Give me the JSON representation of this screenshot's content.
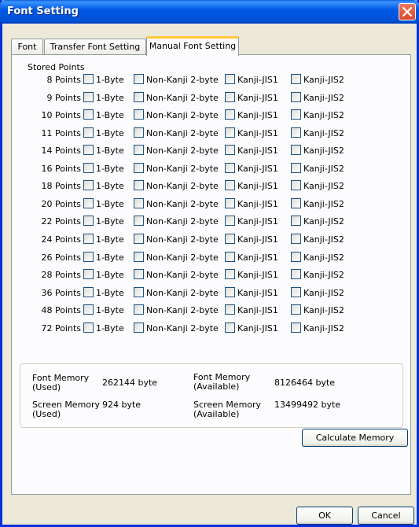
{
  "window": {
    "title": "Font Setting"
  },
  "tabs": [
    {
      "label": "Font"
    },
    {
      "label": "Transfer Font Setting"
    },
    {
      "label": "Manual Font Setting"
    }
  ],
  "stored_points": {
    "caption": "Stored Points",
    "columns": [
      "1-Byte",
      "Non-Kanji 2-byte",
      "Kanji-JIS1",
      "Kanji-JIS2"
    ],
    "rows": [
      "8 Points",
      "9 Points",
      "10 Points",
      "11 Points",
      "14 Points",
      "16 Points",
      "18 Points",
      "20 Points",
      "22 Points",
      "24 Points",
      "26 Points",
      "28 Points",
      "36 Points",
      "48 Points",
      "72 Points"
    ],
    "checked": false
  },
  "memory": {
    "font_used_label": "Font Memory (Used)",
    "font_used_value": "262144 byte",
    "font_avail_label": "Font Memory (Available)",
    "font_avail_value": "8126464 byte",
    "screen_used_label": "Screen Memory (Used)",
    "screen_used_value": "924 byte",
    "screen_avail_label": "Screen Memory (Available)",
    "screen_avail_value": "13499492 byte"
  },
  "buttons": {
    "calculate": "Calculate Memory",
    "ok": "OK",
    "cancel": "Cancel"
  }
}
